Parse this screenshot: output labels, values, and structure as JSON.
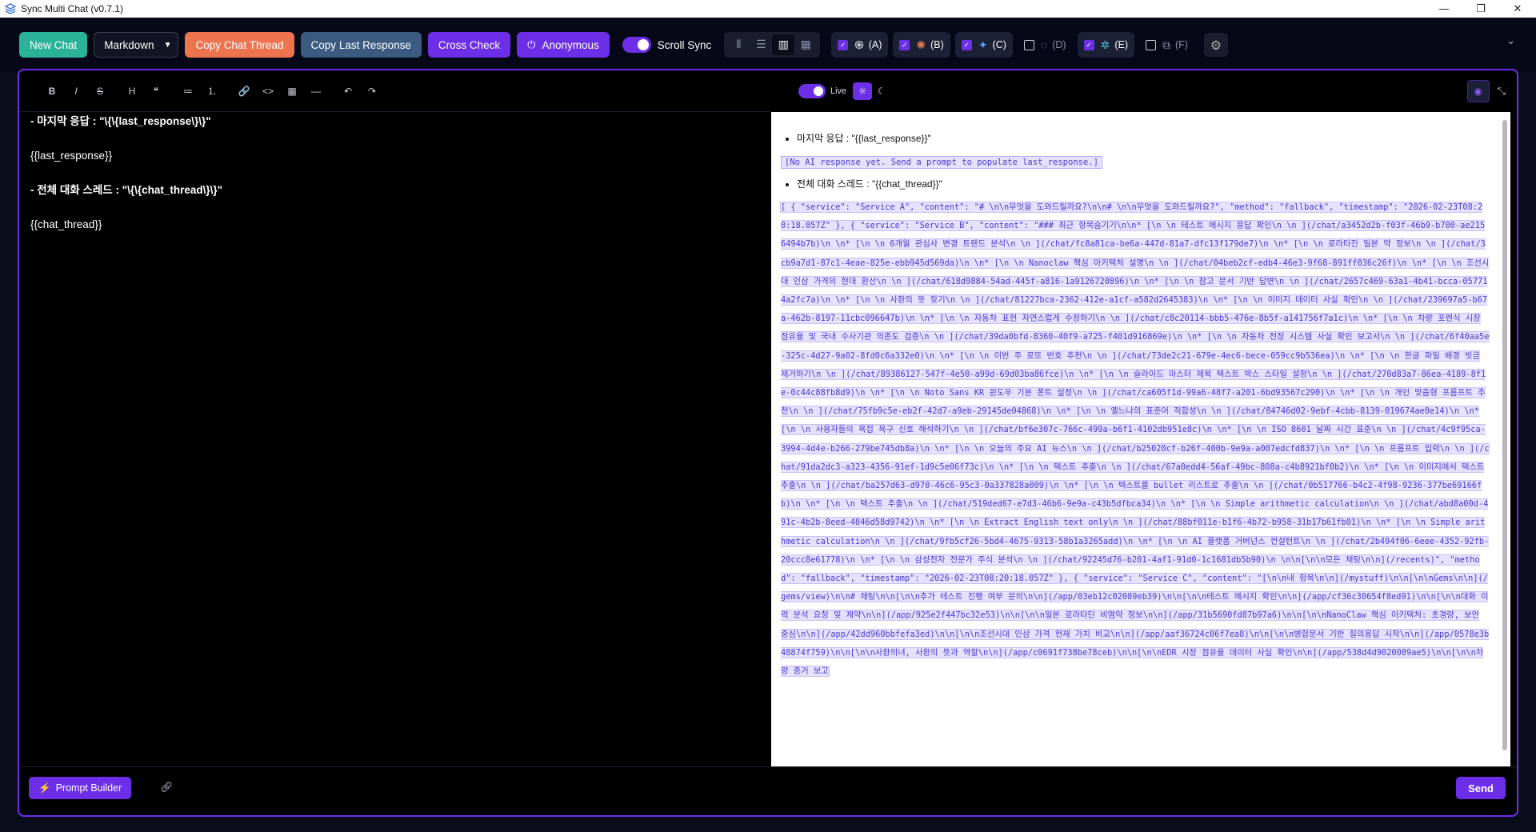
{
  "window": {
    "title": "Sync Multi Chat (v0.7.1)",
    "minimize": "—",
    "maximize": "❐",
    "close": "✕"
  },
  "toolbar": {
    "new_chat": "New Chat",
    "format_select": "Markdown",
    "copy_thread": "Copy Chat Thread",
    "copy_last": "Copy Last Response",
    "cross_check": "Cross Check",
    "anonymous": "Anonymous",
    "scroll_sync": "Scroll Sync",
    "services": [
      {
        "label": "(A)",
        "checked": true,
        "icon": "openai-icon"
      },
      {
        "label": "(B)",
        "checked": true,
        "icon": "claude-icon"
      },
      {
        "label": "(C)",
        "checked": true,
        "icon": "gemini-icon"
      },
      {
        "label": "(D)",
        "checked": false,
        "icon": "chat-bubble-icon"
      },
      {
        "label": "(E)",
        "checked": true,
        "icon": "grok-icon"
      },
      {
        "label": "(F)",
        "checked": false,
        "icon": "perplexity-icon"
      }
    ]
  },
  "editor": {
    "toolbar": [
      "B",
      "I",
      "S",
      "H",
      "❝",
      "≔",
      "⒈",
      "🔗",
      "<>",
      "▦",
      "—",
      "↶",
      "↷"
    ],
    "lines": [
      "- 마지막 응답 : \"\\{\\{last_response\\}\\}\"",
      "{{last_response}}",
      "- 전체 대화 스레드 : \"\\{\\{chat_thread\\}\\}\"",
      "{{chat_thread}}"
    ]
  },
  "preview": {
    "live_label": "Live",
    "bullet1": "마지막 응답 : \"{{last_response}}\"",
    "note": "[No AI response yet. Send a prompt to populate last_response.]",
    "bullet2": "전체 대화 스레드 : \"{{chat_thread}}\"",
    "code": "[ { \"service\": \"Service A\", \"content\": \"# \\n\\n무엇을 도와드릴까요?\\n\\n# \\n\\n무엇을 도와드릴까요?\", \"method\": \"fallback\", \"timestamp\": \"2026-02-23T08:20:18.057Z\" }, { \"service\": \"Service B\", \"content\": \"### 최근 항목숨기기\\n\\n* [\\n \\n 테스트 메시지 응답 확인\\n \\n ](/chat/a3452d2b-f03f-46b9-b700-ae2156494b7b)\\n \\n* [\\n \\n 6개월 관심사 변경 트렌드 분석\\n \\n ](/chat/fc8a81ca-be6a-447d-81a7-dfc13f179de7)\\n \\n* [\\n \\n 로라타진 일본 약 정보\\n \\n ](/chat/3cb9a7d1-87c1-4eae-825e-ebb945d569da)\\n \\n* [\\n \\n Nanoclaw 핵심 아키텍처 설명\\n \\n ](/chat/04beb2cf-edb4-46e3-9f68-891ff036c26f)\\n \\n* [\\n \\n 조선시대 인삼 가격의 현대 환산\\n \\n ](/chat/618d9884-54ad-445f-a816-1a9126720896)\\n \\n* [\\n \\n 참고 문서 기반 답변\\n \\n ](/chat/2657c469-63a1-4b41-bcca-057714a2fc7a)\\n \\n* [\\n \\n 사환의 뜻 찾기\\n \\n ](/chat/81227bca-2362-412e-a1cf-a582d2645383)\\n \\n* [\\n \\n 이미지 데이터 사실 확인\\n \\n ](/chat/239697a5-b67a-462b-8197-11cbc096647b)\\n \\n* [\\n \\n 자동차 표현 자연스럽게 수정하기\\n \\n ](/chat/c8c20114-bbb5-476e-8b5f-a141756f7a1c)\\n \\n* [\\n \\n 차량 포렌식 시장 점유율 및 국내 수사기관 의존도 검증\\n \\n ](/chat/39da0bfd-8360-40f9-a725-f401d916869e)\\n \\n* [\\n \\n 자동차 전장 시스템 사실 확인 보고서\\n \\n ](/chat/6f40aa5e-325c-4d27-9a02-8fd0c6a332e0)\\n \\n* [\\n \\n 이번 주 로또 번호 추천\\n \\n ](/chat/73de2c21-679e-4ec6-bece-059cc9b536ea)\\n \\n* [\\n \\n 한글 파일 배경 빗금 제거하기\\n \\n ](/chat/89386127-547f-4e50-a99d-69d03ba86fce)\\n \\n* [\\n \\n 슬라이드 마스터 제목 텍스트 박스 스타일 설정\\n \\n ](/chat/270d83a7-86ea-4189-8f1e-0c44c88fb8d9)\\n \\n* [\\n \\n Noto Sans KR 윈도우 기본 폰트 설정\\n \\n ](/chat/ca605f1d-99a6-48f7-a201-6bd93567c290)\\n \\n* [\\n \\n 개인 맞춤형 프롬프트 추천\\n \\n ](/chat/75fb9c5e-eb2f-42d7-a9eb-29145de04868)\\n \\n* [\\n \\n 옐느나의 표준어 적합성\\n \\n ](/chat/84746d02-9ebf-4cbb-8139-019674ae0e14)\\n \\n* [\\n \\n 사용자들의 욕접 욕구 신호 해석하기\\n \\n ](/chat/bf6e307c-766c-499a-b6f1-4102db951e8c)\\n \\n* [\\n \\n ISO 8601 날짜 시간 표준\\n \\n ](/chat/4c9f95ca-3994-4d4e-b266-279be745db8a)\\n \\n* [\\n \\n 오늘의 주요 AI 뉴스\\n \\n ](/chat/b25020cf-b26f-400b-9e9a-a007edcfd837)\\n \\n* [\\n \\n 프롬프트 입력\\n \\n ](/chat/91da2dc3-a323-4356-91ef-1d9c5e06f73c)\\n \\n* [\\n \\n 텍스트 추출\\n \\n ](/chat/67a0edd4-56af-49bc-808a-c4b8921bf0b2)\\n \\n* [\\n \\n 이미지에서 텍스트 추출\\n \\n ](/chat/ba257d63-d970-46c6-95c3-0a337828a009)\\n \\n* [\\n \\n 텍스트를 bullet 리스트로 추출\\n \\n ](/chat/0b517766-b4c2-4f98-9236-377be69166fb)\\n \\n* [\\n \\n 텍스트 추출\\n \\n ](/chat/519ded67-e7d3-46b6-9e9a-c43b5dfbca34)\\n \\n* [\\n \\n Simple arithmetic calculation\\n \\n ](/chat/abd8a00d-491c-4b2b-8eed-4846d58d9742)\\n \\n* [\\n \\n Extract English text only\\n \\n ](/chat/88bf011e-b1f6-4b72-b958-31b17b61fb01)\\n \\n* [\\n \\n Simple arithmetic calculation\\n \\n ](/chat/9fb5cf26-5bd4-4675-9313-58b1a3265add)\\n \\n* [\\n \\n AI 플랫폼 거버넌스 컨설턴트\\n \\n ](/chat/2b494f06-6eee-4352-92fb-20ccc8e61778)\\n \\n* [\\n \\n 삼성전자 전문가 주식 분석\\n \\n ](/chat/92245d76-b201-4af1-91d0-1c1681db5b90)\\n \\n\\n[\\n\\n모든 채팅\\n\\n](/recents)\", \"method\": \"fallback\", \"timestamp\": \"2026-02-23T08:20:18.057Z\" }, { \"service\": \"Service C\", \"content\": \"[\\n\\n내 항목\\n\\n](/mystuff)\\n\\n[\\n\\nGems\\n\\n](/gems/view)\\n\\n# 채팅\\n\\n[\\n\\n추가 테스트 진행 여부 문의\\n\\n](/app/03eb12c02089eb39)\\n\\n[\\n\\n테스트 메시지 확인\\n\\n](/app/cf36c30654f8ed91)\\n\\n[\\n\\n대화 이력 분석 요청 및 제약\\n\\n](/app/925e2f447bc32e53)\\n\\n[\\n\\n일본 로라타딘 비염약 정보\\n\\n](/app/31b5690fd87b97a6)\\n\\n[\\n\\nNanoClaw 핵심 아키텍처: 초경량, 보안 중심\\n\\n](/app/42dd960bbfefa3ed)\\n\\n[\\n\\n조선시대 인삼 가격 현재 가치 비교\\n\\n](/app/aaf36724c06f7ea8)\\n\\n[\\n\\n병합문서 기반 질의응답 시작\\n\\n](/app/0578e3b48874f759)\\n\\n[\\n\\n사환의녀, 사환의 뜻과 역할\\n\\n](/app/c0691f738be78ceb)\\n\\n[\\n\\nEDR 시장 점유율 데이터 사실 확인\\n\\n](/app/538d4d9020089ae5)\\n\\n[\\n\\n차량 증거 보고"
  },
  "bottom": {
    "prompt_builder": "Prompt Builder",
    "send": "Send"
  }
}
